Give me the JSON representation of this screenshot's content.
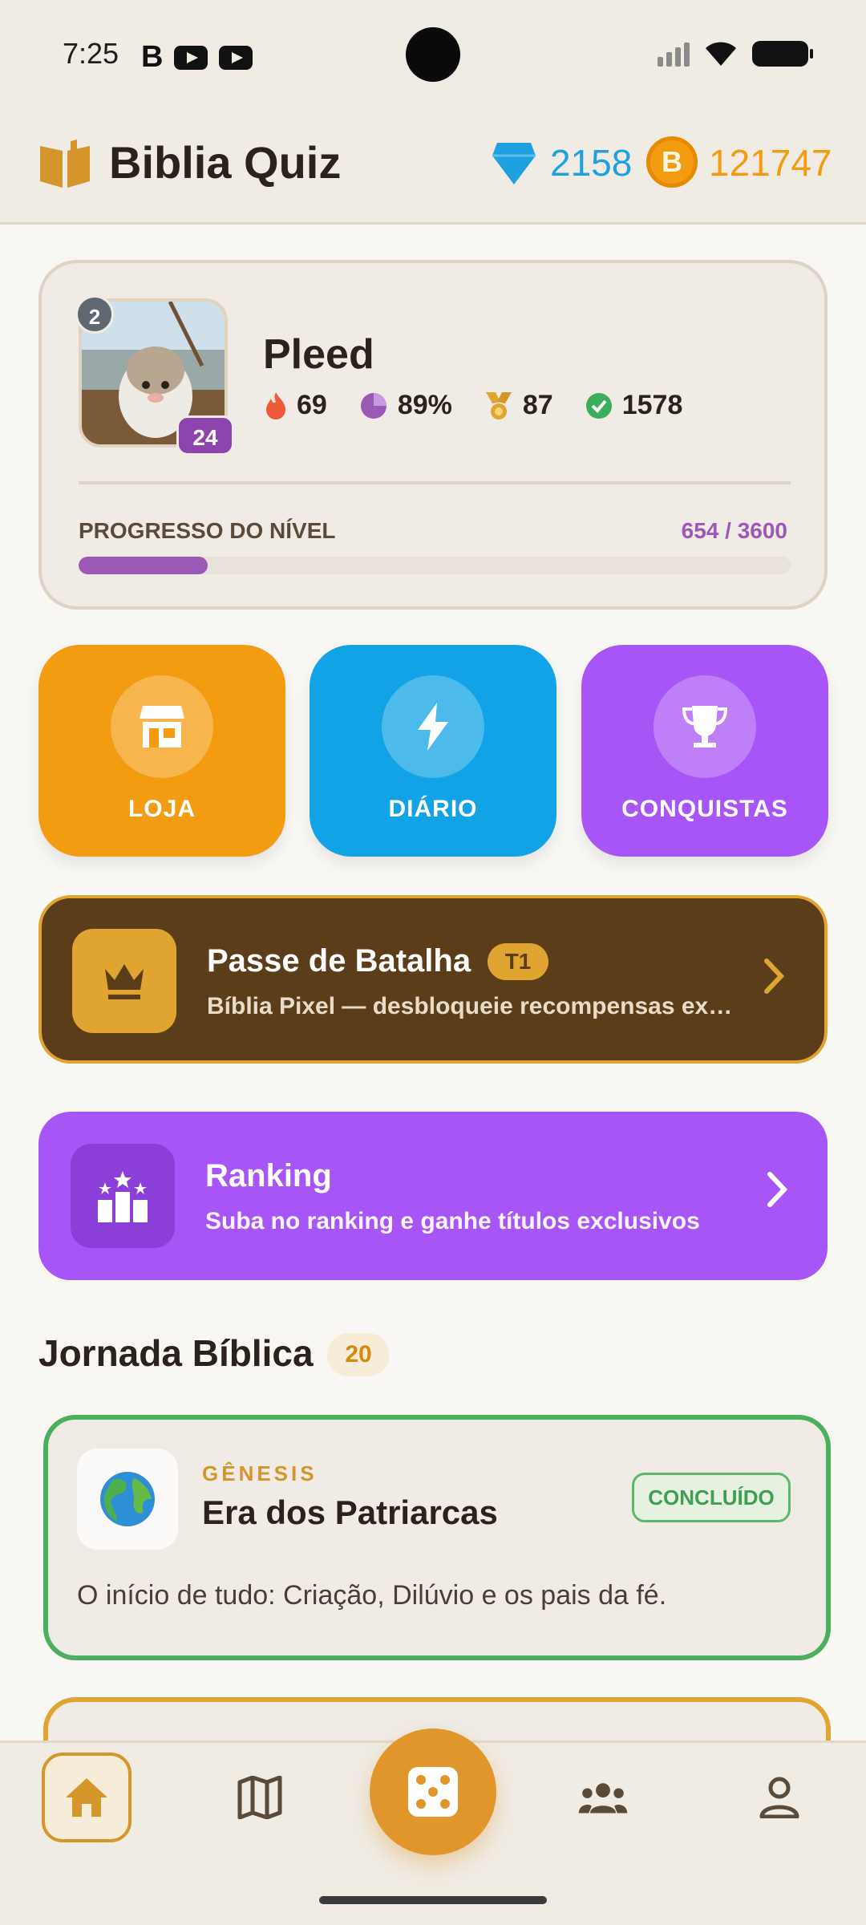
{
  "status_bar": {
    "time": "7:25",
    "left_icons": [
      "b-icon",
      "youtube-icon",
      "youtube-icon"
    ],
    "right_icons": [
      "signal-icon",
      "wifi-icon",
      "battery-icon"
    ]
  },
  "header": {
    "title": "Biblia Quiz",
    "gems": "2158",
    "coin_symbol": "B",
    "coins": "121747",
    "colors": {
      "gems": "#1fa0e0",
      "coins": "#f39c12"
    }
  },
  "profile": {
    "username": "Pleed",
    "level": "2",
    "avatar_badge": "24",
    "stats": {
      "streak": "69",
      "accuracy": "89%",
      "medals": "87",
      "correct": "1578"
    },
    "progress": {
      "label": "PROGRESSO DO NÍVEL",
      "value_text": "654 / 3600",
      "current": 654,
      "max": 3600
    }
  },
  "quick_actions": [
    {
      "label": "LOJA",
      "icon": "store-icon",
      "color": "#f39c12"
    },
    {
      "label": "DIÁRIO",
      "icon": "lightning-icon",
      "color": "#12a3e6"
    },
    {
      "label": "CONQUISTAS",
      "icon": "trophy-icon",
      "color": "#a855f7"
    }
  ],
  "battle_pass": {
    "title": "Passe de Batalha",
    "badge": "T1",
    "subtitle": "Bíblia Pixel — desbloqueie recompensas ex…",
    "icon": "crown-icon"
  },
  "ranking": {
    "title": "Ranking",
    "subtitle": "Suba no ranking e ganhe títulos exclusivos",
    "icon": "podium-stars-icon"
  },
  "journey": {
    "title": "Jornada Bíblica",
    "count": "20",
    "cards": [
      {
        "book": "GÊNESIS",
        "title": "Era dos Patriarcas",
        "status": "CONCLUÍDO",
        "description": "O início de tudo: Criação, Dilúvio e os pais da fé.",
        "icon": "globe-icon"
      }
    ]
  },
  "bottom_nav": {
    "items": [
      "home-icon",
      "map-icon",
      "dice-icon",
      "group-icon",
      "person-icon"
    ],
    "active": "home-icon"
  }
}
